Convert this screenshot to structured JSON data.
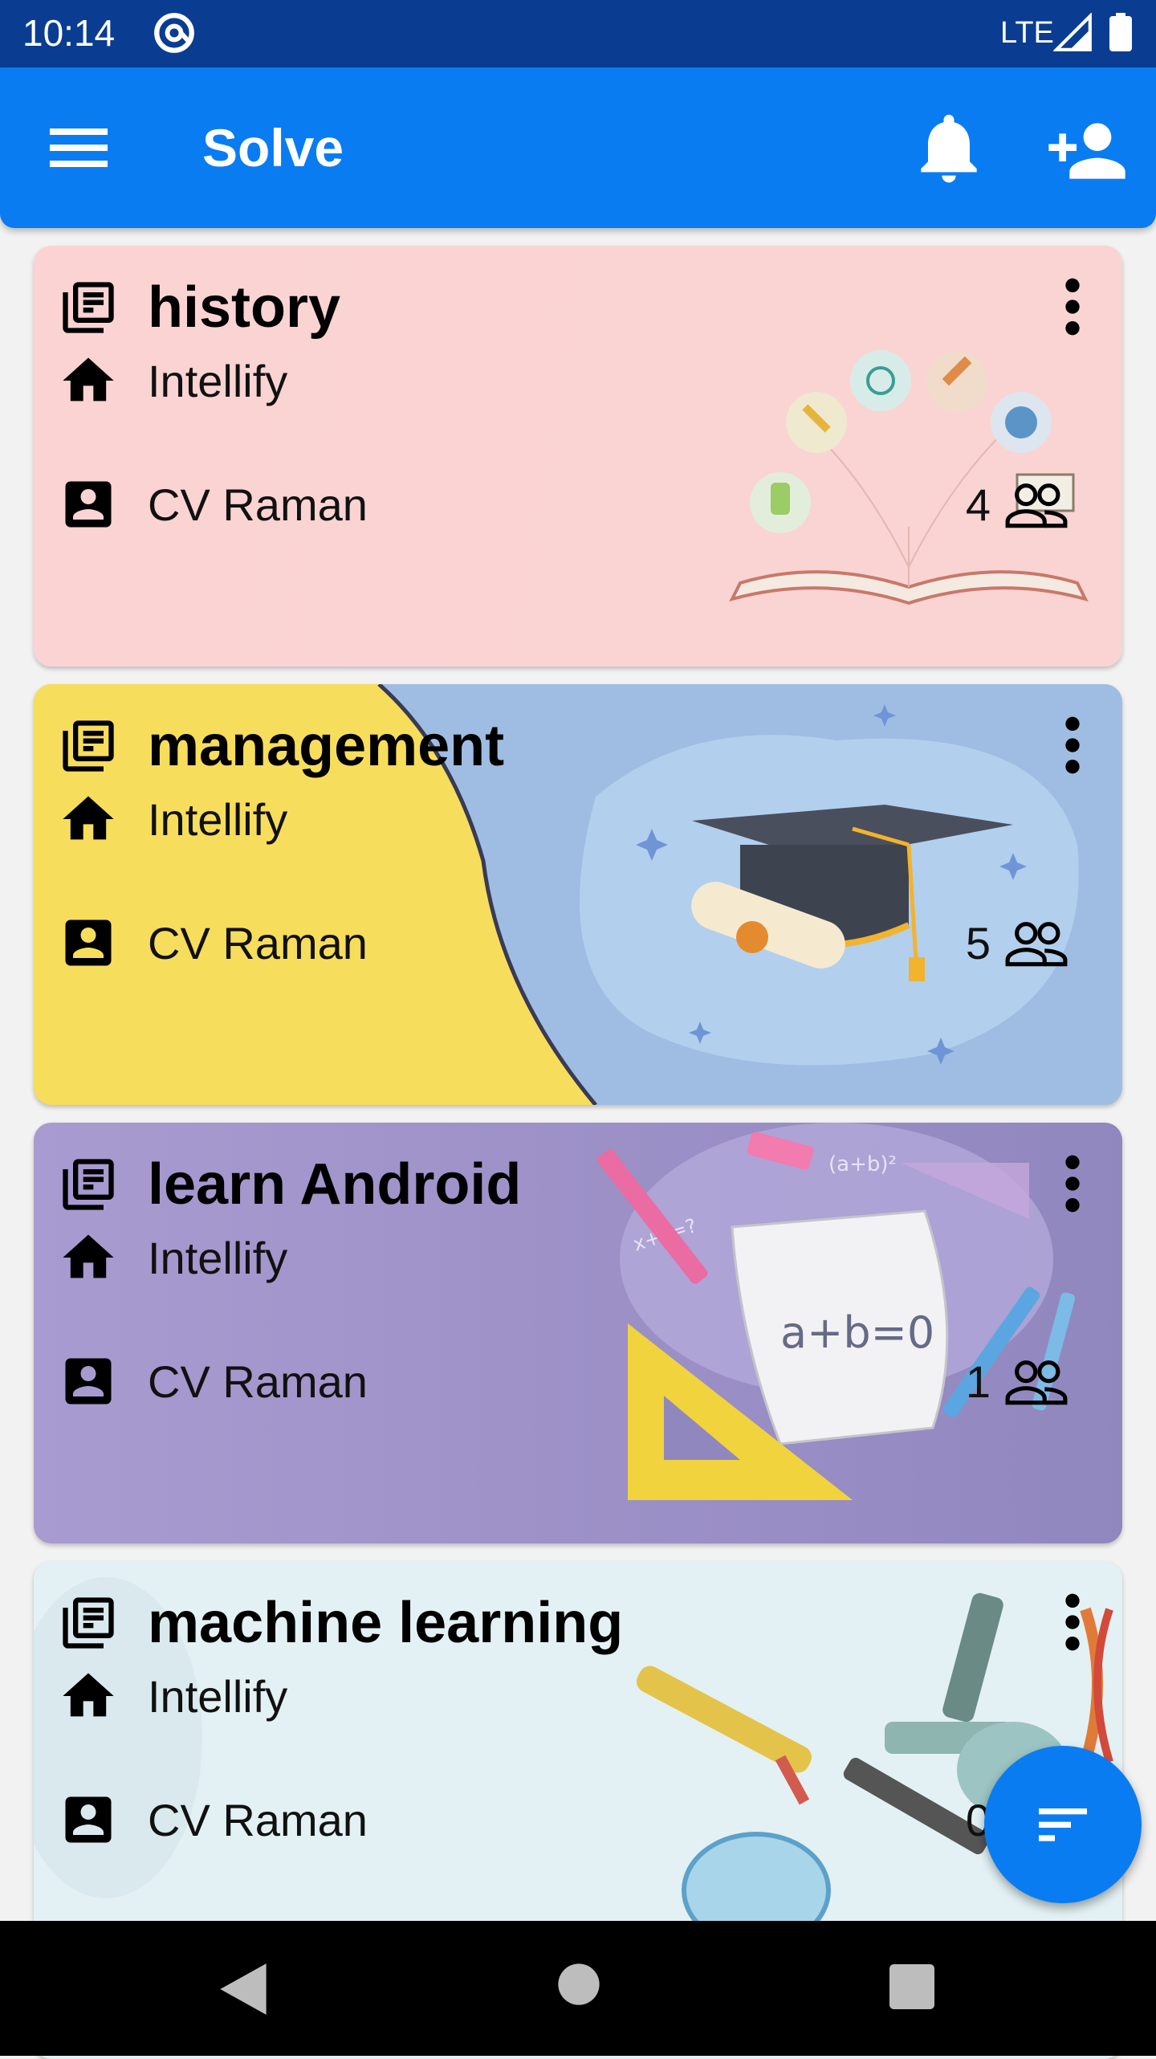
{
  "status_bar": {
    "time": "10:14",
    "network": "LTE"
  },
  "app_bar": {
    "title": "Solve"
  },
  "classes": [
    {
      "title": "history",
      "organization": "Intellify",
      "teacher": "CV Raman",
      "members": "4"
    },
    {
      "title": "management",
      "organization": "Intellify",
      "teacher": "CV Raman",
      "members": "5"
    },
    {
      "title": "learn Android",
      "organization": "Intellify",
      "teacher": "CV Raman",
      "members": "1"
    },
    {
      "title": "machine learning",
      "organization": "Intellify",
      "teacher": "CV Raman",
      "members": "0"
    }
  ],
  "icons": {
    "menu": "menu-icon",
    "notifications": "bell-icon",
    "add_member": "person-add-icon",
    "class": "library-books-icon",
    "organization": "home-icon",
    "teacher": "account-box-icon",
    "more": "more-vert-icon",
    "members": "people-outline-icon",
    "filter": "sort-icon"
  },
  "colors": {
    "status_bar": "#0a3d91",
    "app_bar": "#0a7cf2",
    "fab": "#0a7cf2",
    "card_history": "#fbd3d3",
    "card_management": "#9fbde3",
    "card_android": "#9f95cc",
    "card_ml": "#e3f1f4"
  }
}
